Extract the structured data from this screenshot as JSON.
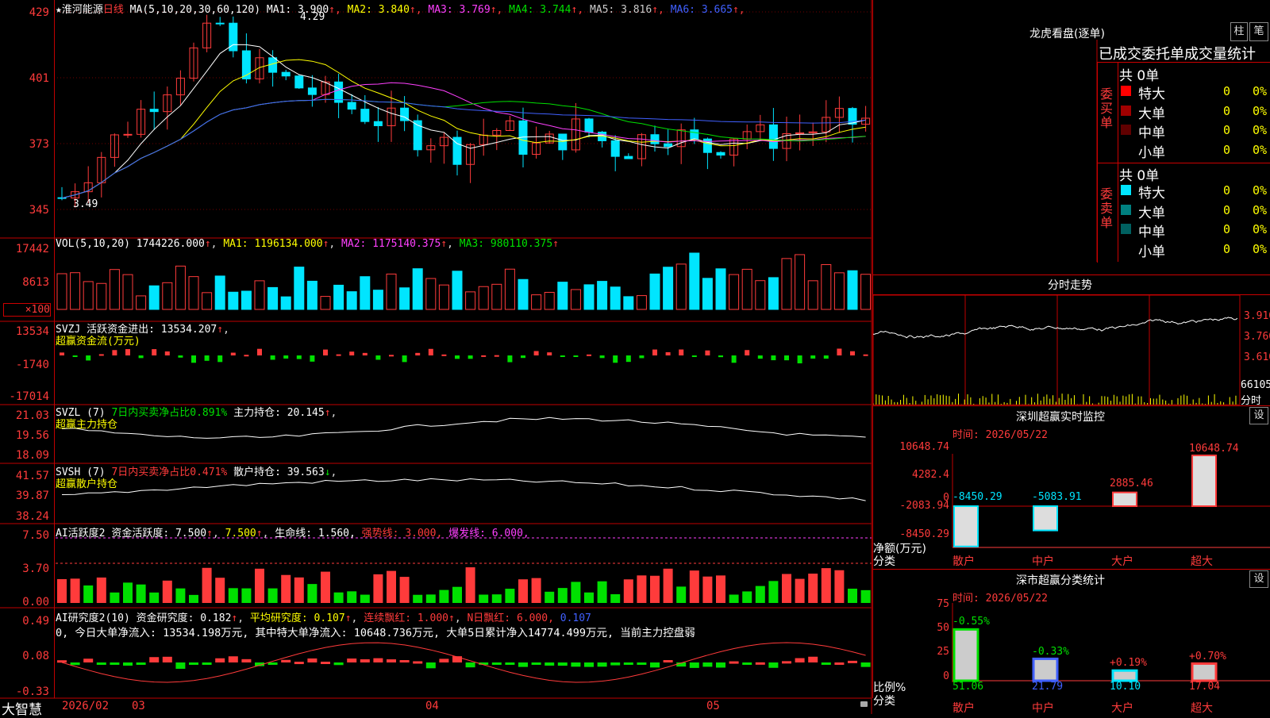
{
  "stock": {
    "name": "★淮河能源",
    "period": "日线",
    "ma_title": "MA(5,10,20,30,60,120)",
    "ma": [
      {
        "label": "MA1:",
        "value": "3.900",
        "color": "#ffffff"
      },
      {
        "label": "MA2:",
        "value": "3.840",
        "color": "#ffff00"
      },
      {
        "label": "MA3:",
        "value": "3.769",
        "color": "#ff40ff"
      },
      {
        "label": "MA4:",
        "value": "3.744",
        "color": "#00e000"
      },
      {
        "label": "MA5:",
        "value": "3.816",
        "color": "#cccccc"
      },
      {
        "label": "MA6:",
        "value": "3.665",
        "color": "#4060ff"
      }
    ],
    "high_mark": "4.29",
    "low_mark": "3.49",
    "axis": [
      "429",
      "401",
      "373",
      "345"
    ]
  },
  "vol": {
    "title": "VOL(5,10,20)",
    "value": "1744226.000",
    "ma1": "MA1: 1196134.000",
    "ma2": "MA2: 1175140.375",
    "ma3": "MA3: 980110.375",
    "axis": [
      "17442",
      "8613",
      "×100"
    ]
  },
  "svzj": {
    "title": "SVZJ",
    "text": "活跃资金进出: 13534.207",
    "sub": "超赢资金流(万元)",
    "axis": [
      "13534",
      "-1740",
      "-17014"
    ]
  },
  "svzl": {
    "title": "SVZL (7)",
    "text1": "7日内买卖净占比0.891%",
    "text2": "主力持仓: 20.145",
    "sub": "超赢主力持仓",
    "axis": [
      "21.03",
      "19.56",
      "18.09"
    ]
  },
  "svsh": {
    "title": "SVSH (7)",
    "text1": "7日内买卖净占比0.471%",
    "text2": "散户持仓: 39.563",
    "sub": "超赢散户持仓",
    "axis": [
      "41.57",
      "39.87",
      "38.24"
    ]
  },
  "ai1": {
    "title": "AI活跃度2",
    "t1": "资金活跃度: 7.500",
    "t2": "7.500",
    "t3": "生命线: 1.560,",
    "t4": "强势线: 3.000,",
    "t5": "爆发线: 6.000,",
    "axis": [
      "7.50",
      "3.70",
      "0.00"
    ]
  },
  "ai2": {
    "title": "AI研究度2(10)",
    "t1": "资金研究度: 0.182",
    "t2": "平均研究度: 0.107",
    "t3": "连续飘红: 1.000",
    "t4": "N日飘红: 6.000,",
    "t5": "0.107",
    "summary": "0, 今日大单净流入: 13534.198万元, 其中特大单净流入: 10648.736万元, 大单5日累计净入14774.499万元, 当前主力控盘弱",
    "axis": [
      "0.49",
      "0.08",
      "-0.33"
    ]
  },
  "footer": {
    "brand": "大智慧",
    "dates": [
      "2026/02",
      "03",
      "04",
      "05"
    ]
  },
  "right": {
    "lhb_title": "龙虎看盘(逐单)",
    "btn_zhu": "柱",
    "btn_bi": "笔",
    "tongji_title": "已成交委托单成交量统计",
    "buy_label": "委买单",
    "sell_label": "委卖单",
    "buy_total": "共 0单",
    "sell_total": "共 0单",
    "buy_rows": [
      {
        "name": "特大",
        "count": "0",
        "pct": "0%",
        "color": "#ff0000"
      },
      {
        "name": "大单",
        "count": "0",
        "pct": "0%",
        "color": "#a00000"
      },
      {
        "name": "中单",
        "count": "0",
        "pct": "0%",
        "color": "#600000"
      },
      {
        "name": "小单",
        "count": "0",
        "pct": "0%",
        "color": "#000000"
      }
    ],
    "sell_rows": [
      {
        "name": "特大",
        "count": "0",
        "pct": "0%",
        "color": "#00e5ff"
      },
      {
        "name": "大单",
        "count": "0",
        "pct": "0%",
        "color": "#008080"
      },
      {
        "name": "中单",
        "count": "0",
        "pct": "0%",
        "color": "#006060"
      },
      {
        "name": "小单",
        "count": "0",
        "pct": "0%",
        "color": "#000000"
      }
    ],
    "fenshi_title": "分时走势",
    "fenshi_axis": [
      "3.910",
      "3.760",
      "3.610",
      "66105",
      "分时"
    ],
    "monitor_title": "深圳超赢实时监控",
    "set1": "设",
    "monitor_time": "时间: 2026/05/22",
    "monitor_axis": [
      "10648.74",
      "4282.4",
      "0",
      "-2083.94",
      "-8450.29"
    ],
    "monitor_vals": [
      "-8450.29",
      "-5083.91",
      "2885.46",
      "10648.74"
    ],
    "monitor_ylabel": "净额(万元)",
    "monitor_xlabel": "分类",
    "cats": [
      "散户",
      "中户",
      "大户",
      "超大"
    ],
    "class_title": "深市超赢分类统计",
    "set2": "设",
    "class_time": "时间: 2026/05/22",
    "class_axis": [
      "75",
      "50",
      "25",
      "0"
    ],
    "class_changes": [
      "-0.55%",
      "-0.33%",
      "+0.19%",
      "+0.70%"
    ],
    "class_vals": [
      "51.06",
      "21.79",
      "10.10",
      "17.04"
    ],
    "class_ylabel": "比例%",
    "class_xlabel": "分类"
  },
  "chart_data": {
    "type": "bar",
    "title": "深圳超赢实时监控",
    "categories": [
      "散户",
      "中户",
      "大户",
      "超大"
    ],
    "values": [
      -8450.29,
      -5083.91,
      2885.46,
      10648.74
    ],
    "ylabel": "净额(万元)",
    "ylim": [
      -8450.29,
      10648.74
    ]
  }
}
